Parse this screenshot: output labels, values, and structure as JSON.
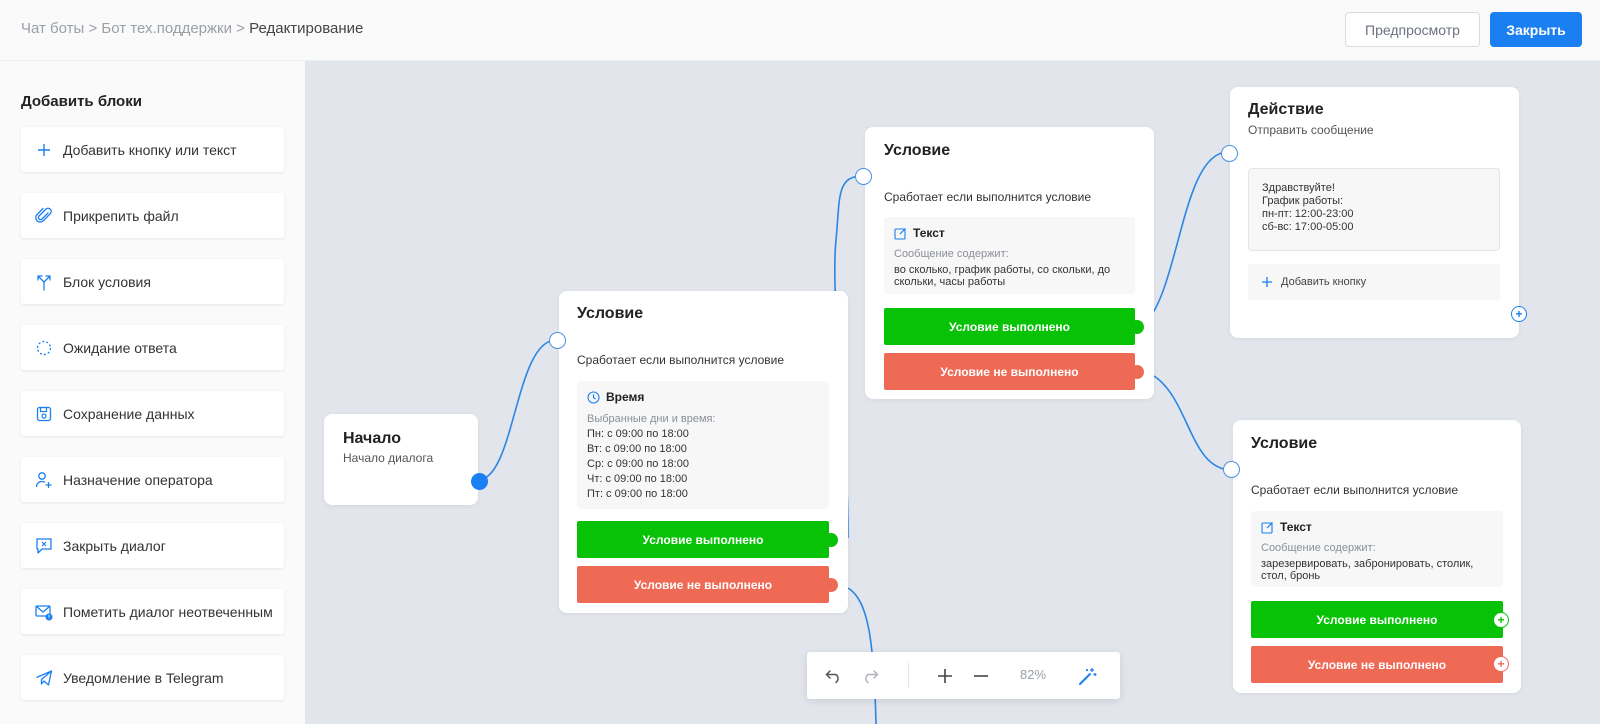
{
  "header": {
    "breadcrumb": [
      "Чат боты",
      "Бот тех.поддержки",
      "Редактирование"
    ],
    "separator": ">",
    "preview_label": "Предпросмотр",
    "close_label": "Закрыть"
  },
  "sidebar": {
    "title": "Добавить блоки",
    "items": [
      {
        "label": "Добавить кнопку или текст",
        "icon": "plus-icon"
      },
      {
        "label": "Прикрепить файл",
        "icon": "paperclip-icon"
      },
      {
        "label": "Блок условия",
        "icon": "branch-icon"
      },
      {
        "label": "Ожидание ответа",
        "icon": "dotted-circle-icon"
      },
      {
        "label": "Сохранение данных",
        "icon": "save-icon"
      },
      {
        "label": "Назначение оператора",
        "icon": "user-add-icon"
      },
      {
        "label": "Закрыть диалог",
        "icon": "chat-close-icon"
      },
      {
        "label": "Пометить диалог неотвеченным",
        "icon": "mail-alert-icon"
      },
      {
        "label": "Уведомление в Telegram",
        "icon": "telegram-icon"
      }
    ]
  },
  "nodes": {
    "start": {
      "title": "Начало",
      "subtitle": "Начало диалога"
    },
    "cond_time": {
      "title": "Условие",
      "description": "Сработает если выполнится условие",
      "inner_title": "Время",
      "inner_label": "Выбранные дни и время:",
      "schedule": [
        "Пн: с 09:00 по 18:00",
        "Вт: с 09:00 по 18:00",
        "Ср: с 09:00 по 18:00",
        "Чт: с 09:00 по 18:00",
        "Пт: с 09:00 по 18:00"
      ],
      "ok_label": "Условие выполнено",
      "fail_label": "Условие не выполнено"
    },
    "cond_text_top": {
      "title": "Условие",
      "description": "Сработает если выполнится условие",
      "inner_title": "Текст",
      "inner_label": "Сообщение содержит:",
      "inner_text": "во сколько, график работы, со скольки, до скольки, часы работы",
      "ok_label": "Условие выполнено",
      "fail_label": "Условие не выполнено"
    },
    "action": {
      "title": "Действие",
      "subtitle": "Отправить сообщение",
      "message": "Здравствуйте!\nГрафик работы:\nпн-пт: 12:00-23:00\nсб-вс: 17:00-05:00",
      "add_button_label": "Добавить кнопку"
    },
    "cond_text_bottom": {
      "title": "Условие",
      "description": "Сработает если выполнится условие",
      "inner_title": "Текст",
      "inner_label": "Сообщение содержит:",
      "inner_text": "зарезервировать, забронировать, столик, стол, бронь",
      "ok_label": "Условие выполнено",
      "fail_label": "Условие не выполнено"
    }
  },
  "toolbar": {
    "zoom_level": "82%",
    "icons": [
      "undo-icon",
      "redo-icon",
      "zoom-in-icon",
      "zoom-out-icon",
      "magic-wand-icon"
    ]
  },
  "colors": {
    "accent": "#1a7ff0",
    "success": "#07c207",
    "failure": "#ee6a55",
    "wire": "#2b86e6",
    "canvas": "#e2e5ec"
  }
}
